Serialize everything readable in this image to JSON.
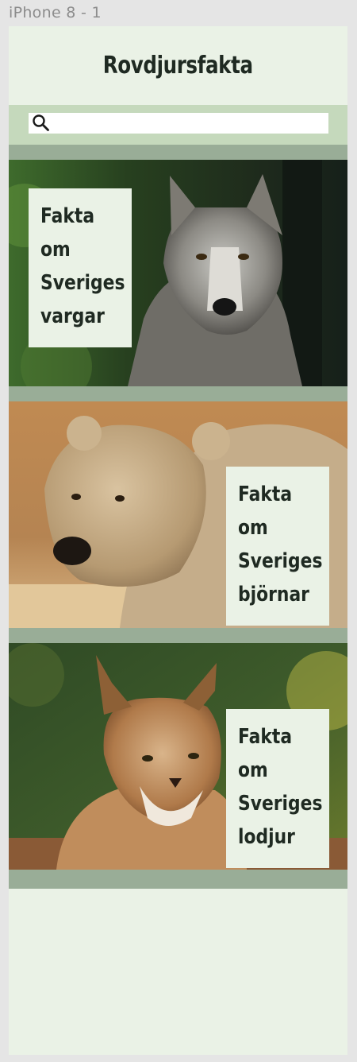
{
  "frame": {
    "label": "iPhone 8 - 1"
  },
  "header": {
    "title": "Rovdjursfakta"
  },
  "search": {
    "placeholder": "",
    "value": "",
    "icon": "search-icon"
  },
  "cards": [
    {
      "animal": "wolf",
      "lines": [
        "Fakta",
        "om",
        "Sveriges",
        "vargar"
      ]
    },
    {
      "animal": "bear",
      "lines": [
        "Fakta",
        "om",
        "Sveriges",
        "björnar"
      ]
    },
    {
      "animal": "lynx",
      "lines": [
        "Fakta",
        "om",
        "Sveriges",
        "lodjur"
      ]
    }
  ],
  "colors": {
    "background": "#eaf2e6",
    "search_band": "#c5d9bc",
    "separator": "#99ad97",
    "text": "#1f2a22"
  }
}
